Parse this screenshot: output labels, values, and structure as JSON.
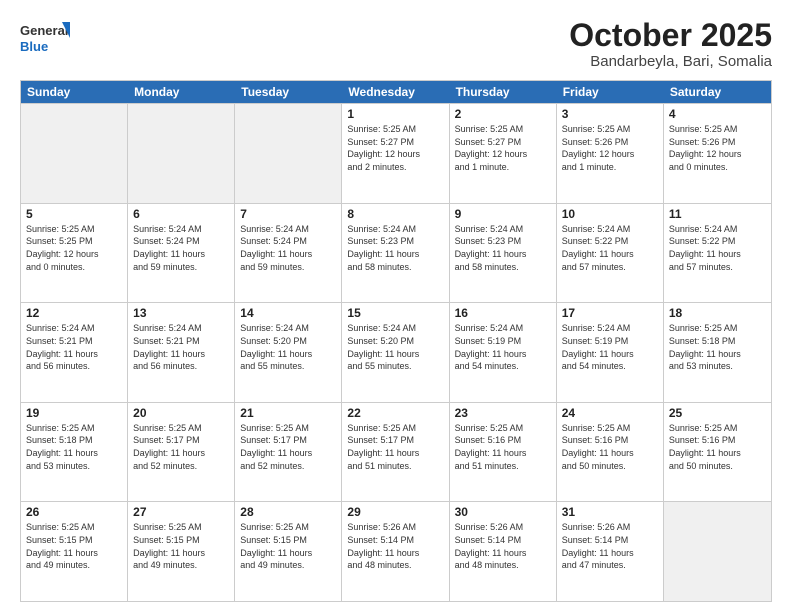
{
  "header": {
    "logo_general": "General",
    "logo_blue": "Blue",
    "month": "October 2025",
    "location": "Bandarbeyla, Bari, Somalia"
  },
  "days_of_week": [
    "Sunday",
    "Monday",
    "Tuesday",
    "Wednesday",
    "Thursday",
    "Friday",
    "Saturday"
  ],
  "weeks": [
    [
      {
        "day": "",
        "info": "",
        "shaded": true
      },
      {
        "day": "",
        "info": "",
        "shaded": true
      },
      {
        "day": "",
        "info": "",
        "shaded": true
      },
      {
        "day": "1",
        "info": "Sunrise: 5:25 AM\nSunset: 5:27 PM\nDaylight: 12 hours\nand 2 minutes.",
        "shaded": false
      },
      {
        "day": "2",
        "info": "Sunrise: 5:25 AM\nSunset: 5:27 PM\nDaylight: 12 hours\nand 1 minute.",
        "shaded": false
      },
      {
        "day": "3",
        "info": "Sunrise: 5:25 AM\nSunset: 5:26 PM\nDaylight: 12 hours\nand 1 minute.",
        "shaded": false
      },
      {
        "day": "4",
        "info": "Sunrise: 5:25 AM\nSunset: 5:26 PM\nDaylight: 12 hours\nand 0 minutes.",
        "shaded": false
      }
    ],
    [
      {
        "day": "5",
        "info": "Sunrise: 5:25 AM\nSunset: 5:25 PM\nDaylight: 12 hours\nand 0 minutes.",
        "shaded": false
      },
      {
        "day": "6",
        "info": "Sunrise: 5:24 AM\nSunset: 5:24 PM\nDaylight: 11 hours\nand 59 minutes.",
        "shaded": false
      },
      {
        "day": "7",
        "info": "Sunrise: 5:24 AM\nSunset: 5:24 PM\nDaylight: 11 hours\nand 59 minutes.",
        "shaded": false
      },
      {
        "day": "8",
        "info": "Sunrise: 5:24 AM\nSunset: 5:23 PM\nDaylight: 11 hours\nand 58 minutes.",
        "shaded": false
      },
      {
        "day": "9",
        "info": "Sunrise: 5:24 AM\nSunset: 5:23 PM\nDaylight: 11 hours\nand 58 minutes.",
        "shaded": false
      },
      {
        "day": "10",
        "info": "Sunrise: 5:24 AM\nSunset: 5:22 PM\nDaylight: 11 hours\nand 57 minutes.",
        "shaded": false
      },
      {
        "day": "11",
        "info": "Sunrise: 5:24 AM\nSunset: 5:22 PM\nDaylight: 11 hours\nand 57 minutes.",
        "shaded": false
      }
    ],
    [
      {
        "day": "12",
        "info": "Sunrise: 5:24 AM\nSunset: 5:21 PM\nDaylight: 11 hours\nand 56 minutes.",
        "shaded": false
      },
      {
        "day": "13",
        "info": "Sunrise: 5:24 AM\nSunset: 5:21 PM\nDaylight: 11 hours\nand 56 minutes.",
        "shaded": false
      },
      {
        "day": "14",
        "info": "Sunrise: 5:24 AM\nSunset: 5:20 PM\nDaylight: 11 hours\nand 55 minutes.",
        "shaded": false
      },
      {
        "day": "15",
        "info": "Sunrise: 5:24 AM\nSunset: 5:20 PM\nDaylight: 11 hours\nand 55 minutes.",
        "shaded": false
      },
      {
        "day": "16",
        "info": "Sunrise: 5:24 AM\nSunset: 5:19 PM\nDaylight: 11 hours\nand 54 minutes.",
        "shaded": false
      },
      {
        "day": "17",
        "info": "Sunrise: 5:24 AM\nSunset: 5:19 PM\nDaylight: 11 hours\nand 54 minutes.",
        "shaded": false
      },
      {
        "day": "18",
        "info": "Sunrise: 5:25 AM\nSunset: 5:18 PM\nDaylight: 11 hours\nand 53 minutes.",
        "shaded": false
      }
    ],
    [
      {
        "day": "19",
        "info": "Sunrise: 5:25 AM\nSunset: 5:18 PM\nDaylight: 11 hours\nand 53 minutes.",
        "shaded": false
      },
      {
        "day": "20",
        "info": "Sunrise: 5:25 AM\nSunset: 5:17 PM\nDaylight: 11 hours\nand 52 minutes.",
        "shaded": false
      },
      {
        "day": "21",
        "info": "Sunrise: 5:25 AM\nSunset: 5:17 PM\nDaylight: 11 hours\nand 52 minutes.",
        "shaded": false
      },
      {
        "day": "22",
        "info": "Sunrise: 5:25 AM\nSunset: 5:17 PM\nDaylight: 11 hours\nand 51 minutes.",
        "shaded": false
      },
      {
        "day": "23",
        "info": "Sunrise: 5:25 AM\nSunset: 5:16 PM\nDaylight: 11 hours\nand 51 minutes.",
        "shaded": false
      },
      {
        "day": "24",
        "info": "Sunrise: 5:25 AM\nSunset: 5:16 PM\nDaylight: 11 hours\nand 50 minutes.",
        "shaded": false
      },
      {
        "day": "25",
        "info": "Sunrise: 5:25 AM\nSunset: 5:16 PM\nDaylight: 11 hours\nand 50 minutes.",
        "shaded": false
      }
    ],
    [
      {
        "day": "26",
        "info": "Sunrise: 5:25 AM\nSunset: 5:15 PM\nDaylight: 11 hours\nand 49 minutes.",
        "shaded": false
      },
      {
        "day": "27",
        "info": "Sunrise: 5:25 AM\nSunset: 5:15 PM\nDaylight: 11 hours\nand 49 minutes.",
        "shaded": false
      },
      {
        "day": "28",
        "info": "Sunrise: 5:25 AM\nSunset: 5:15 PM\nDaylight: 11 hours\nand 49 minutes.",
        "shaded": false
      },
      {
        "day": "29",
        "info": "Sunrise: 5:26 AM\nSunset: 5:14 PM\nDaylight: 11 hours\nand 48 minutes.",
        "shaded": false
      },
      {
        "day": "30",
        "info": "Sunrise: 5:26 AM\nSunset: 5:14 PM\nDaylight: 11 hours\nand 48 minutes.",
        "shaded": false
      },
      {
        "day": "31",
        "info": "Sunrise: 5:26 AM\nSunset: 5:14 PM\nDaylight: 11 hours\nand 47 minutes.",
        "shaded": false
      },
      {
        "day": "",
        "info": "",
        "shaded": true
      }
    ]
  ]
}
